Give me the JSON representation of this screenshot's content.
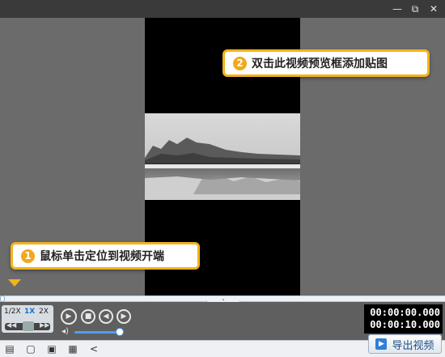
{
  "window": {
    "minimize_glyph": "—",
    "restore_glyph": "⧉",
    "close_glyph": "✕"
  },
  "callouts": {
    "preview_tip": {
      "number": "2",
      "text": "双击此视频预览框添加贴图"
    },
    "timeline_tip": {
      "number": "1",
      "text": "鼠标单击定位到视频开端"
    }
  },
  "colors": {
    "accent": "#f2b21a",
    "preview_bg": "#6b6b6b",
    "timeline_bg": "#eef2f7",
    "volume": "#4ea0f0"
  },
  "speed": {
    "options": [
      "1/2X",
      "1X",
      "2X"
    ],
    "active": "1X",
    "rail_left": "◀◀",
    "rail_right": "▶▶"
  },
  "playback": {
    "play_icon": "▶",
    "stop_icon": "■",
    "prev_icon": "◀",
    "next_icon": "▶"
  },
  "volume": {
    "icon": "◂)",
    "level": 0.9
  },
  "time": {
    "current": "00:00:00.000",
    "total": "00:00:10.000"
  },
  "collapse_glyph": "ˇ",
  "toolbar": {
    "icons": [
      "new-project-icon",
      "open-folder-icon",
      "save-icon",
      "save-as-icon",
      "share-icon"
    ],
    "glyphs": [
      "▤",
      "▢",
      "▣",
      "▦",
      "<"
    ]
  },
  "export": {
    "label": "导出视频",
    "icon": "▶"
  }
}
